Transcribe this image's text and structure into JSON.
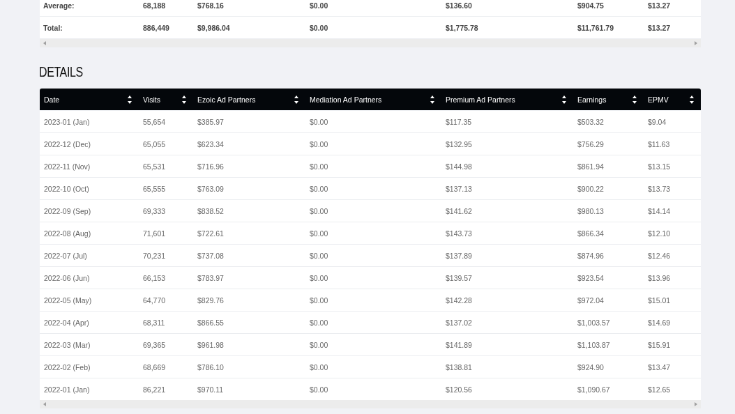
{
  "summary": {
    "rows": [
      {
        "label": "Average:",
        "cells": [
          "68,188",
          "$768.16",
          "$0.00",
          "$136.60",
          "$904.75",
          "$13.27"
        ]
      },
      {
        "label": "Total:",
        "cells": [
          "886,449",
          "$9,986.04",
          "$0.00",
          "$1,775.78",
          "$11,761.79",
          "$13.27"
        ]
      }
    ]
  },
  "details": {
    "title": "DETAILS",
    "columns": [
      "Date",
      "Visits",
      "Ezoic Ad Partners",
      "Mediation Ad Partners",
      "Premium Ad Partners",
      "Earnings",
      "EPMV"
    ],
    "rows": [
      [
        "2023-01 (Jan)",
        "55,654",
        "$385.97",
        "$0.00",
        "$117.35",
        "$503.32",
        "$9.04"
      ],
      [
        "2022-12 (Dec)",
        "65,055",
        "$623.34",
        "$0.00",
        "$132.95",
        "$756.29",
        "$11.63"
      ],
      [
        "2022-11 (Nov)",
        "65,531",
        "$716.96",
        "$0.00",
        "$144.98",
        "$861.94",
        "$13.15"
      ],
      [
        "2022-10 (Oct)",
        "65,555",
        "$763.09",
        "$0.00",
        "$137.13",
        "$900.22",
        "$13.73"
      ],
      [
        "2022-09 (Sep)",
        "69,333",
        "$838.52",
        "$0.00",
        "$141.62",
        "$980.13",
        "$14.14"
      ],
      [
        "2022-08 (Aug)",
        "71,601",
        "$722.61",
        "$0.00",
        "$143.73",
        "$866.34",
        "$12.10"
      ],
      [
        "2022-07 (Jul)",
        "70,231",
        "$737.08",
        "$0.00",
        "$137.89",
        "$874.96",
        "$12.46"
      ],
      [
        "2022-06 (Jun)",
        "66,153",
        "$783.97",
        "$0.00",
        "$139.57",
        "$923.54",
        "$13.96"
      ],
      [
        "2022-05 (May)",
        "64,770",
        "$829.76",
        "$0.00",
        "$142.28",
        "$972.04",
        "$15.01"
      ],
      [
        "2022-04 (Apr)",
        "68,311",
        "$866.55",
        "$0.00",
        "$137.02",
        "$1,003.57",
        "$14.69"
      ],
      [
        "2022-03 (Mar)",
        "69,365",
        "$961.98",
        "$0.00",
        "$141.89",
        "$1,103.87",
        "$15.91"
      ],
      [
        "2022-02 (Feb)",
        "68,669",
        "$786.10",
        "$0.00",
        "$138.81",
        "$924.90",
        "$13.47"
      ],
      [
        "2022-01 (Jan)",
        "86,221",
        "$970.11",
        "$0.00",
        "$120.56",
        "$1,090.67",
        "$12.65"
      ]
    ]
  }
}
